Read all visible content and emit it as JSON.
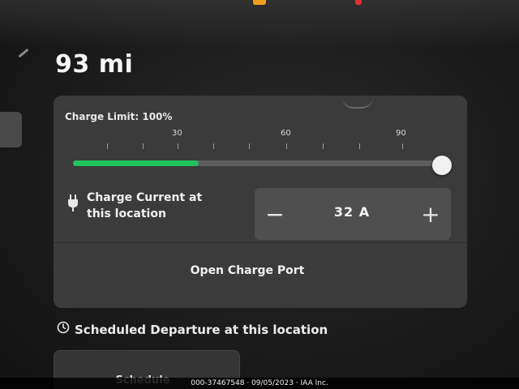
{
  "range": {
    "value": "93 mi"
  },
  "charge_limit": {
    "label": "Charge Limit: 100%",
    "tick_labels": [
      "30",
      "60",
      "90"
    ],
    "fill_fraction": 0.34,
    "fill_color": "#22c25c"
  },
  "charge_current": {
    "icon": "plug-icon",
    "label_line1": "Charge Current at",
    "label_line2": "this location",
    "decrease": "−",
    "value": "32 A",
    "increase": "+"
  },
  "open_charge_port": {
    "label": "Open Charge Port"
  },
  "scheduled_departure": {
    "icon": "clock-icon",
    "title": "Scheduled Departure at this location",
    "schedule_button": "Schedule"
  },
  "watermark": {
    "text": "000-37467548 · 09/05/2023 · IAA Inc."
  }
}
